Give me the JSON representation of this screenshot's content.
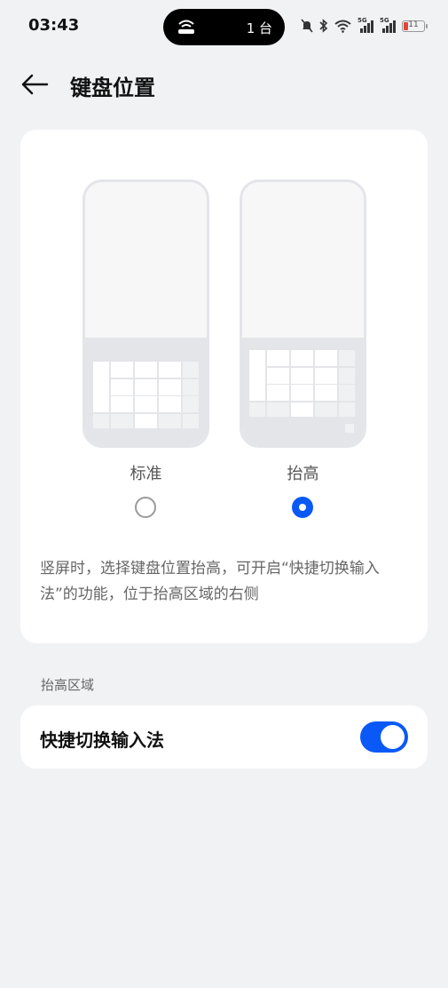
{
  "status_bar": {
    "time": "03:43",
    "devices_label": "1 台",
    "battery_level": "11",
    "signal_1": "5G",
    "signal_2": "5G"
  },
  "header": {
    "title": "键盘位置",
    "back_icon": "arrow-left-icon"
  },
  "keyboard_position": {
    "options": [
      {
        "label": "标准",
        "selected": false
      },
      {
        "label": "抬高",
        "selected": true
      }
    ],
    "description": "竖屏时，选择键盘位置抬高，可开启“快捷切换输入法”的功能，位于抬高区域的右侧"
  },
  "raised_area": {
    "section_title": "抬高区域",
    "quick_switch_label": "快捷切换输入法",
    "quick_switch_on": true
  },
  "colors": {
    "accent": "#0a59f7",
    "background": "#f1f2f4",
    "card": "#ffffff"
  }
}
